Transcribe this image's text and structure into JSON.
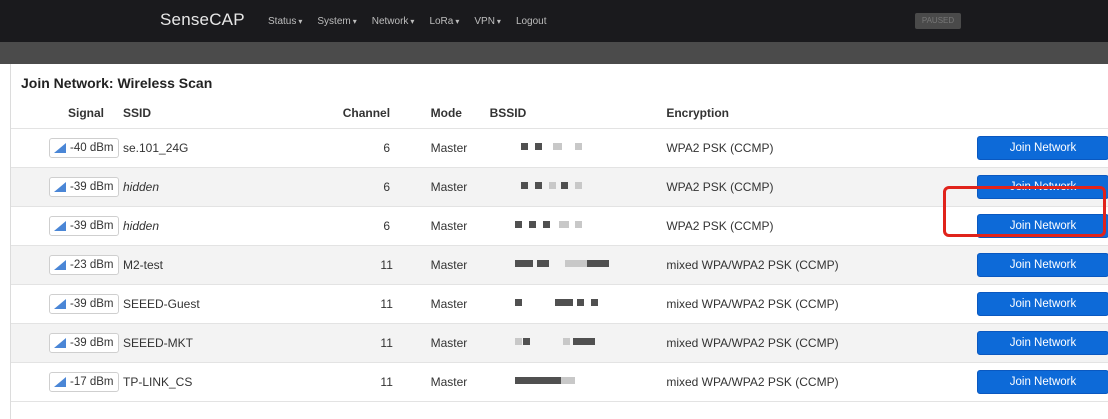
{
  "app": {
    "brand": "SenseCAP",
    "menu": [
      {
        "label": "Status"
      },
      {
        "label": "System"
      },
      {
        "label": "Network"
      },
      {
        "label": "LoRa"
      },
      {
        "label": "VPN"
      },
      {
        "label": "Logout"
      }
    ],
    "status_badge": "PAUSED"
  },
  "page": {
    "title": "Join Network: Wireless Scan",
    "columns": {
      "signal": "Signal",
      "ssid": "SSID",
      "channel": "Channel",
      "mode": "Mode",
      "bssid": "BSSID",
      "encryption": "Encryption"
    },
    "action_label": "Join Network",
    "rows": [
      {
        "signal": "-40 dBm",
        "ssid": "se.101_24G",
        "italic": false,
        "channel": "6",
        "mode": "Master",
        "encryption": "WPA2 PSK (CCMP)",
        "action": "Join Network"
      },
      {
        "signal": "-39 dBm",
        "ssid": "hidden",
        "italic": true,
        "channel": "6",
        "mode": "Master",
        "encryption": "WPA2 PSK (CCMP)",
        "action": "Join Network"
      },
      {
        "signal": "-39 dBm",
        "ssid": "hidden",
        "italic": true,
        "channel": "6",
        "mode": "Master",
        "encryption": "WPA2 PSK (CCMP)",
        "action": "Join Network"
      },
      {
        "signal": "-23 dBm",
        "ssid": "M2-test",
        "italic": false,
        "channel": "11",
        "mode": "Master",
        "encryption": "mixed WPA/WPA2 PSK (CCMP)",
        "action": "Join Network"
      },
      {
        "signal": "-39 dBm",
        "ssid": "SEEED-Guest",
        "italic": false,
        "channel": "11",
        "mode": "Master",
        "encryption": "mixed WPA/WPA2 PSK (CCMP)",
        "action": "Join Network"
      },
      {
        "signal": "-39 dBm",
        "ssid": "SEEED-MKT",
        "italic": false,
        "channel": "11",
        "mode": "Master",
        "encryption": "mixed WPA/WPA2 PSK (CCMP)",
        "action": "Join Network"
      },
      {
        "signal": "-17 dBm",
        "ssid": "TP-LINK_CS",
        "italic": false,
        "channel": "11",
        "mode": "Master",
        "encryption": "mixed WPA/WPA2 PSK (CCMP)",
        "action": "Join Network"
      }
    ]
  },
  "colors": {
    "topbar": "#1a1a1d",
    "button": "#0d6ad8",
    "highlight": "#e0231b",
    "signal_icon": "#4a86d6"
  },
  "icons": {
    "signal": "signal-strength-icon",
    "caret": "chevron-down-icon"
  }
}
